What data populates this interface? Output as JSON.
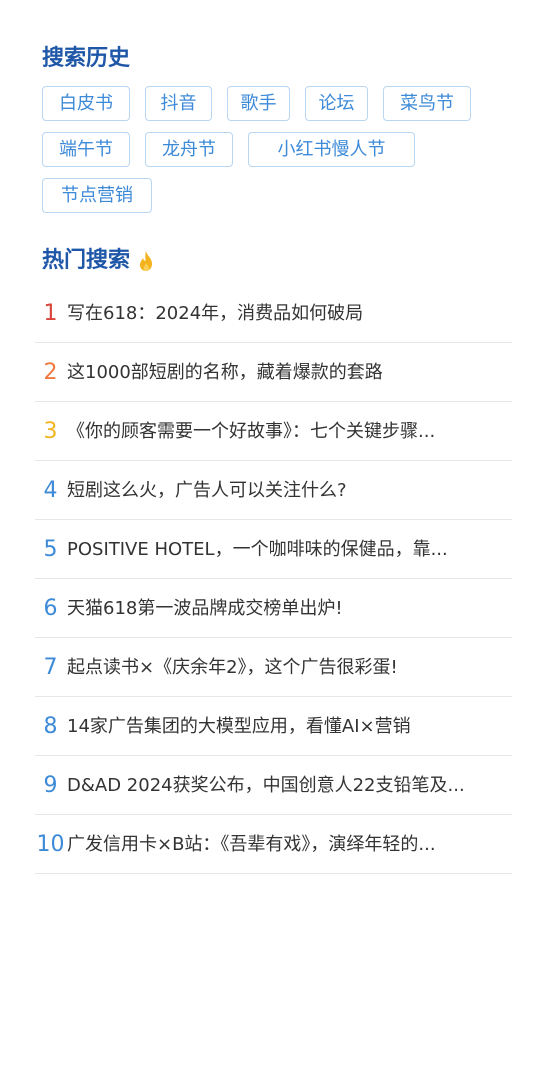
{
  "history": {
    "title": "搜索历史",
    "rows": [
      [
        {
          "label": "白皮书",
          "w": 88
        },
        {
          "label": "抖音",
          "w": 67
        },
        {
          "label": "歌手",
          "w": 63
        },
        {
          "label": "论坛",
          "w": 63
        },
        {
          "label": "菜鸟节",
          "w": 88
        }
      ],
      [
        {
          "label": "端午节",
          "w": 88
        },
        {
          "label": "龙舟节",
          "w": 88
        },
        {
          "label": "小红书慢人节",
          "w": 167
        }
      ],
      [
        {
          "label": "节点营销",
          "w": 110
        }
      ]
    ]
  },
  "hot": {
    "title": "热门搜索",
    "icon": "flame-icon",
    "accent": "#1f57a8",
    "items": [
      {
        "rank": "1",
        "text": "写在618：2024年，消费品如何破局"
      },
      {
        "rank": "2",
        "text": "这1000部短剧的名称，藏着爆款的套路"
      },
      {
        "rank": "3",
        "text": "《你的顾客需要一个好故事》：七个关键步骤..."
      },
      {
        "rank": "4",
        "text": "短剧这么火，广告人可以关注什么?"
      },
      {
        "rank": "5",
        "text": "POSITIVE HOTEL，一个咖啡味的保健品，靠..."
      },
      {
        "rank": "6",
        "text": "天猫618第一波品牌成交榜单出炉!"
      },
      {
        "rank": "7",
        "text": "起点读书×《庆余年2》，这个广告很彩蛋!"
      },
      {
        "rank": "8",
        "text": "14家广告集团的大模型应用，看懂AI×营销"
      },
      {
        "rank": "9",
        "text": "D&AD 2024获奖公布，中国创意人22支铅笔及..."
      },
      {
        "rank": "10",
        "text": "广发信用卡×B站：《吾辈有戏》，演绎年轻的..."
      }
    ]
  }
}
